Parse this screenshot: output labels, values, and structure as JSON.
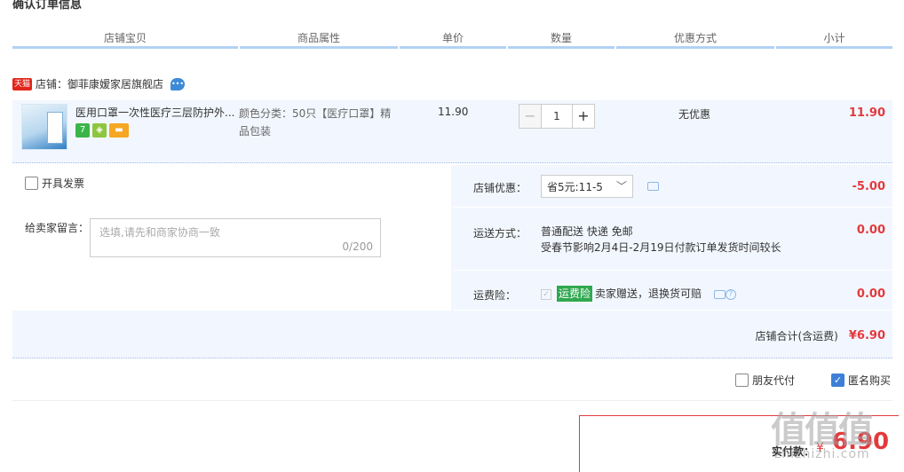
{
  "page": {
    "title": "确认订单信息"
  },
  "columns": [
    "店铺宝贝",
    "商品属性",
    "单价",
    "数量",
    "优惠方式",
    "小计"
  ],
  "shop": {
    "badge": "天猫",
    "label": "店铺：御菲康嫒家居旗舰店"
  },
  "item": {
    "title": "医用口罩一次性医疗三层防护外...",
    "attr": "颜色分类：50只【医疗口罩】精品包装",
    "price": "11.90",
    "quantity": "1",
    "minus": "−",
    "plus": "+",
    "discount": "无优惠",
    "subtotal": "11.90",
    "svc_icons": [
      "7-day-return-icon",
      "guarantee-icon",
      "card-icon"
    ]
  },
  "invoice": {
    "label": "开具发票"
  },
  "note": {
    "label": "给卖家留言：",
    "placeholder": "选填,请先和商家协商一致",
    "count": "0/200"
  },
  "coupon": {
    "label": "店铺优惠：",
    "selected": "省5元:11-5",
    "amount": "-5.00"
  },
  "shipping": {
    "label": "运送方式：",
    "method": "普通配送 快递 免邮",
    "notice": "受春节影响2月4日-2月19日付款订单发货时间较长",
    "amount": "0.00"
  },
  "insurance": {
    "label": "运费险：",
    "badge": "运费险",
    "text": "卖家赠送，退换货可赔",
    "amount": "0.00"
  },
  "shop_total": {
    "label": "店铺合计(含运费)",
    "value": "¥6.90"
  },
  "options": {
    "friend_pay": "朋友代付",
    "anonymous": "匿名购买"
  },
  "payment": {
    "label": "实付款：",
    "symbol": "¥",
    "value": "6.90"
  },
  "watermark": {
    "main": "值值值",
    "sub": "zhizhizhi.com"
  },
  "colors": {
    "accent_red": "#e4393c",
    "blue_bg": "#f2f7ff",
    "header_line": "#b2d1f5",
    "checkbox_blue": "#3d7fd6"
  }
}
